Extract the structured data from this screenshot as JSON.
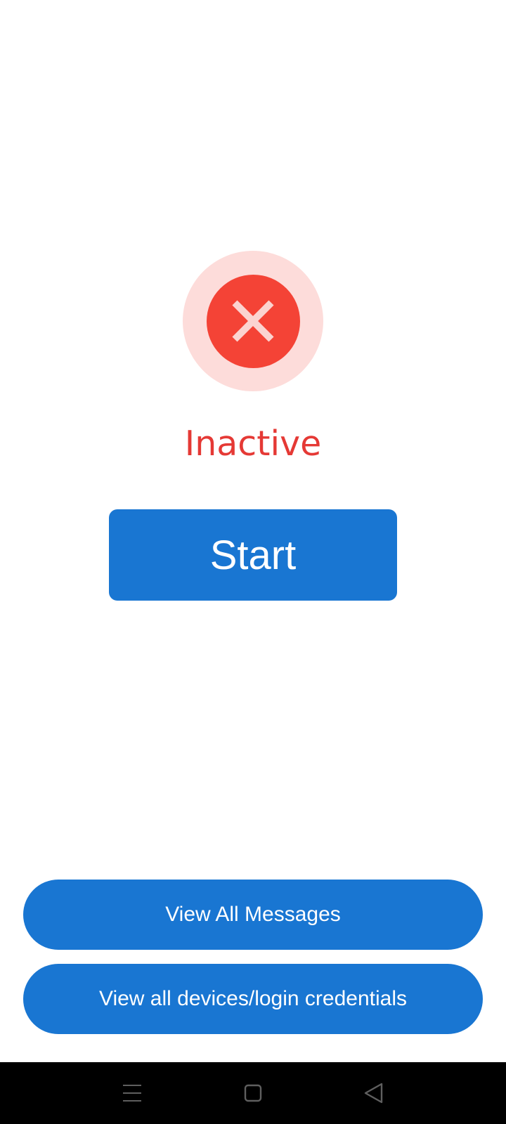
{
  "colors": {
    "background": "#ffffff",
    "status_halo": "#fddcda",
    "status_fill": "#f44336",
    "status_cross": "#fbd3d0",
    "status_text": "#e53935",
    "button_blue": "#1976d2",
    "button_text": "#ffffff",
    "nav_bar": "#000000",
    "nav_icon": "#5f5f5f"
  },
  "status": {
    "icon": "close-icon",
    "label": "Inactive"
  },
  "actions": {
    "start_label": "Start",
    "view_messages_label": "View All Messages",
    "view_devices_label": "View all devices/login credentials"
  },
  "nav": {
    "menu_icon": "menu-icon",
    "home_icon": "home-square-icon",
    "back_icon": "back-triangle-icon"
  }
}
